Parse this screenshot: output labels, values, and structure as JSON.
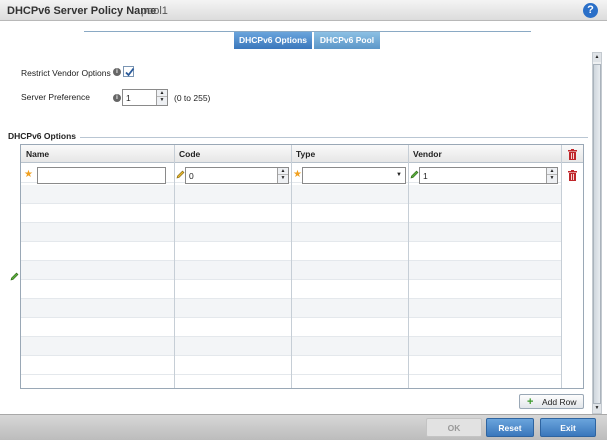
{
  "header": {
    "title_label": "DHCPv6 Server Policy Name",
    "title_value": "pool1",
    "help_glyph": "?"
  },
  "tabs": [
    {
      "label": "DHCPv6 Options",
      "active": true
    },
    {
      "label": "DHCPv6 Pool",
      "active": false
    }
  ],
  "form": {
    "restrict_vendor_label": "Restrict Vendor Options",
    "restrict_vendor_checked": true,
    "server_pref_label": "Server Preference",
    "server_pref_value": "1",
    "server_pref_range": "(0 to 255)"
  },
  "options_group": {
    "title": "DHCPv6 Options",
    "columns": [
      "Name",
      "Code",
      "Type",
      "Vendor"
    ],
    "row": {
      "name": "",
      "code": "0",
      "type": "",
      "vendor": "1"
    }
  },
  "add_row_label": "Add Row",
  "footer": {
    "ok_label": "OK",
    "reset_label": "Reset",
    "exit_label": "Exit"
  },
  "colors": {
    "accent": "#3a77bc",
    "trash": "#c0262a",
    "star": "#f0a020",
    "pencil": "#3a9a2a"
  }
}
